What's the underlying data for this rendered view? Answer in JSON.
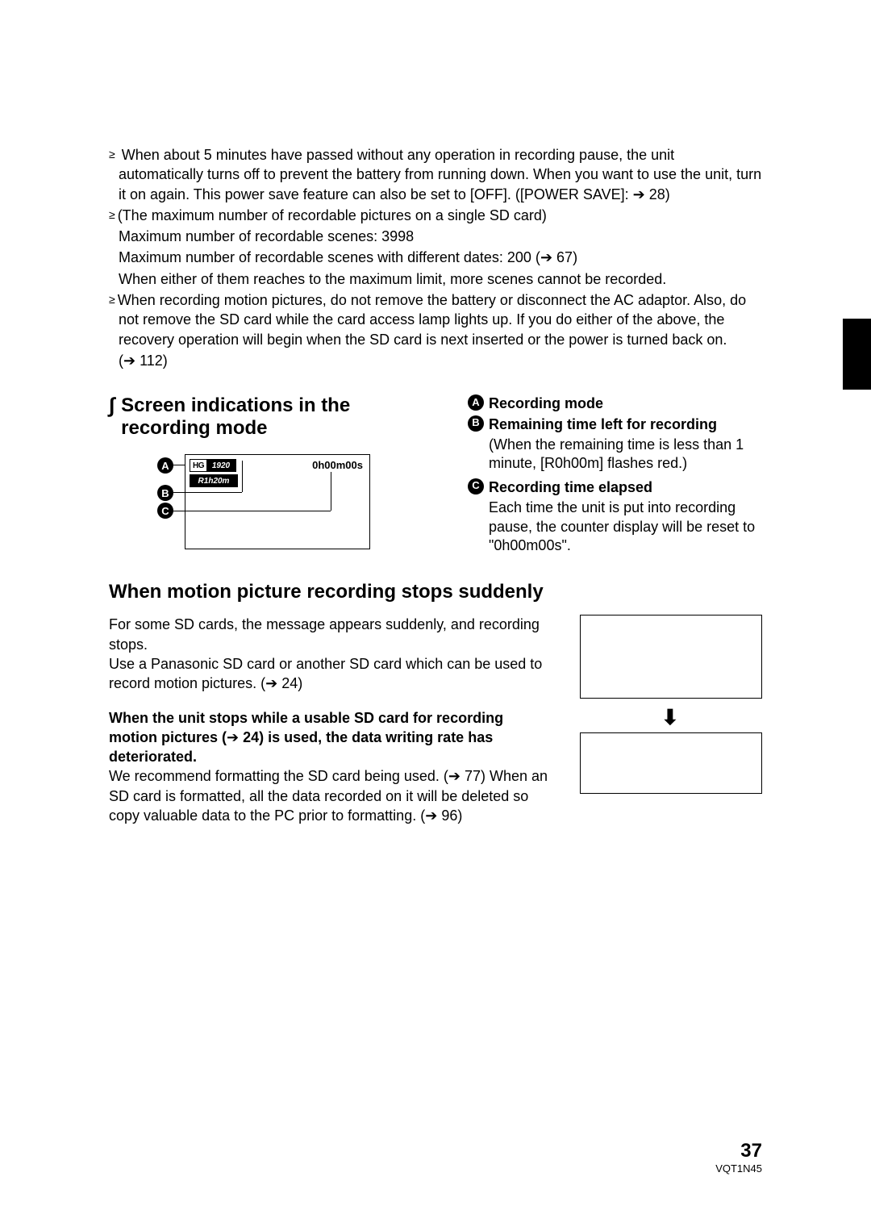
{
  "bullets": {
    "b1": "When about 5 minutes have passed without any operation in recording pause, the unit automatically turns off to prevent the battery from running down. When you want to use the unit, turn it on again. This power save feature can also be set to [OFF]. ([POWER SAVE]: ",
    "b1_ref": "28)",
    "b2_l1": "(The maximum number of recordable pictures on a single SD card)",
    "b2_l2": "Maximum number of recordable scenes: 3998",
    "b2_l3a": "Maximum number of recordable scenes with different dates: 200 (",
    "b2_l3b": "67)",
    "b2_l4": "When either of them reaches to the maximum limit, more scenes cannot be recorded.",
    "b3": "When recording motion pictures, do not remove the battery or disconnect the AC adaptor. Also, do not remove the SD card while the card access lamp lights up. If you do either of the above, the recovery operation will begin when the SD card is next inserted or the power is turned back on.",
    "b3_ref_pre": "(",
    "b3_ref": "112)"
  },
  "section_head": "Screen indications in the recording mode",
  "diagram": {
    "mode_l": "HG",
    "mode_r": "1920",
    "remaining": "R1h20m",
    "elapsed": "0h00m00s"
  },
  "labels": {
    "a": "Recording mode",
    "b": "Remaining time left for recording",
    "b_desc": "(When the remaining time is less than 1 minute, [R0h00m] flashes red.)",
    "c": "Recording time elapsed",
    "c_desc": "Each time the unit is put into recording pause, the counter display will be reset to \"0h00m00s\"."
  },
  "sub_section": {
    "title": "When motion picture recording stops suddenly",
    "p1": "For some SD cards, the message appears suddenly, and recording stops.",
    "p2a": "Use a Panasonic SD card or another SD card which can be used to record motion pictures. (",
    "p2b": "24)",
    "p3a": "When the unit stops while a usable SD card for recording motion pictures (",
    "p3b": "24) is used, the data writing rate has deteriorated.",
    "p4a": "We recommend formatting the SD card being used. (",
    "p4b": "77) When an SD card is formatted, all the data recorded on it will be deleted so copy valuable data to the PC prior to formatting. (",
    "p4c": "96)"
  },
  "footer": {
    "page": "37",
    "doc": "VQT1N45"
  },
  "glyphs": {
    "arrow": "➔",
    "down": "⬇",
    "square": "∫"
  }
}
